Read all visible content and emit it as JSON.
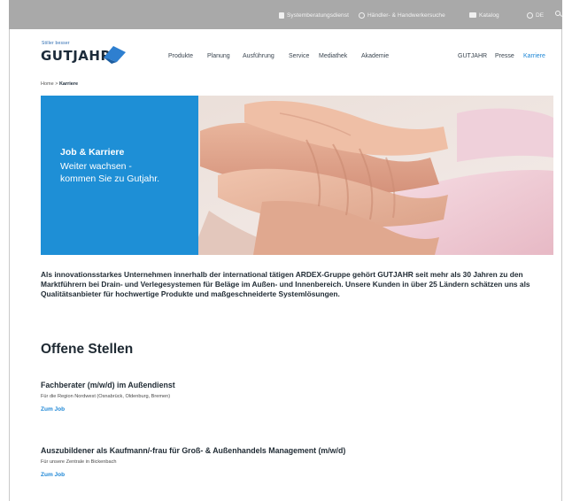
{
  "topbar": {
    "items": [
      {
        "label": "Systemberatungsdienst",
        "icon": "document-icon"
      },
      {
        "label": "Händler- & Handwerkersuche",
        "icon": "location-icon"
      },
      {
        "label": "Katalog",
        "icon": "catalog-icon"
      },
      {
        "label": "DE",
        "icon": "globe-icon"
      }
    ],
    "search_icon": "search-icon"
  },
  "header": {
    "logo_tagline": "Stiller besser",
    "logo_text": "GUTJAHR",
    "nav": [
      "Produkte",
      "Planung",
      "Ausführung",
      "Service",
      "Mediathek",
      "Akademie"
    ],
    "meta_nav": [
      "GUTJAHR",
      "Presse",
      "Karriere"
    ],
    "active_item": "Karriere",
    "accent_color": "#1e87d6"
  },
  "breadcrumb": {
    "home": "Home",
    "separator": ">",
    "current": "Karriere"
  },
  "hero": {
    "title": "Job & Karriere",
    "subtitle": "Weiter wachsen - kommen Sie zu Gutjahr.",
    "panel_color": "#1e8fd6"
  },
  "intro": "Als innovationsstarkes Unternehmen innerhalb der international tätigen ARDEX-Gruppe gehört GUTJAHR seit mehr als 30 Jahren zu den Marktführern bei Drain- und Verlegesystemen für Beläge im Außen- und Innenbereich. Unsere Kunden in über 25 Ländern schätzen uns als Qualitätsanbieter für hochwertige Produkte und maßgeschneiderte Systemlösungen.",
  "openings": {
    "title": "Offene Stellen",
    "jobs": [
      {
        "title": "Fachberater (m/w/d) im Außendienst",
        "desc": "Für die Region Nordwest (Osnabrück, Oldenburg, Bremen)",
        "link": "Zum Job"
      },
      {
        "title": "Auszubildener als Kaufmann/-frau für Groß- & Außenhandels Management (m/w/d)",
        "desc": "Für unsere Zentrale in Bickenbach",
        "link": "Zum Job"
      }
    ]
  }
}
